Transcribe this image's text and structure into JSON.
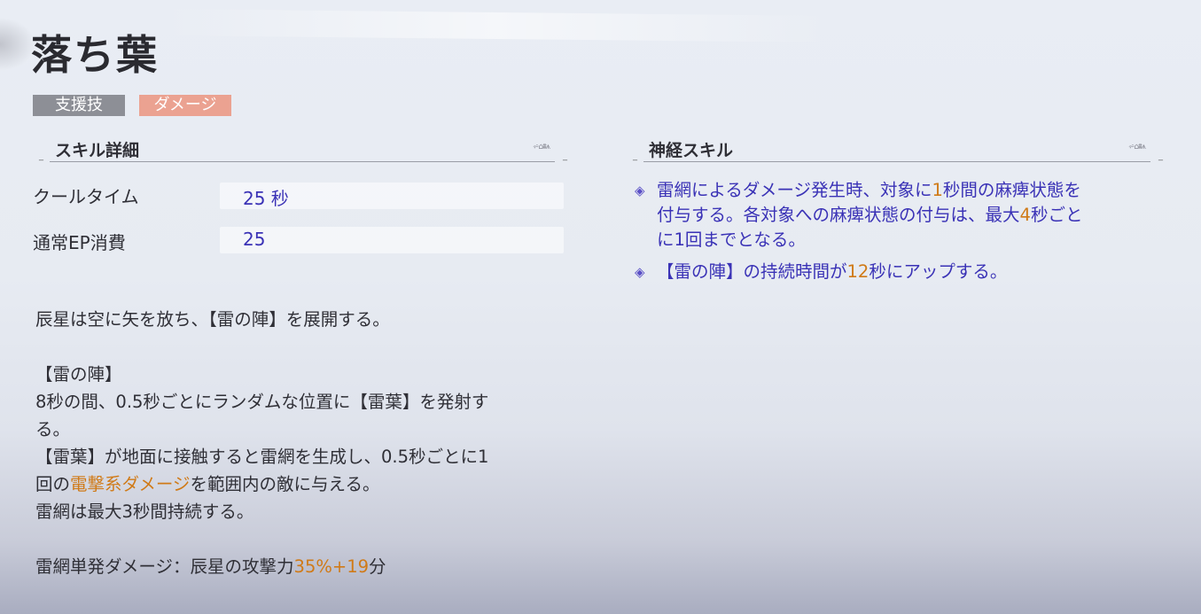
{
  "skill": {
    "title": "落ち葉",
    "tags": [
      "支援技",
      "ダメージ"
    ]
  },
  "details": {
    "section_title": "スキル詳細",
    "cooldown_label": "クールタイム",
    "cooldown_value": "25 秒",
    "ep_label": "通常EP消費",
    "ep_value": "25"
  },
  "description": {
    "line1": "辰星は空に矢を放ち、【雷の陣】を展開する。",
    "line2": "【雷の陣】",
    "line3": "8秒の間、0.5秒ごとにランダムな位置に【雷葉】を発射す",
    "line4": "る。",
    "line5": "【雷葉】が地面に接触すると雷網を生成し、0.5秒ごとに1",
    "line6_pre": "回の",
    "line6_highlight": "電撃系ダメージ",
    "line6_post": "を範囲内の敵に与える。",
    "line7": "雷網は最大3秒間持続する。",
    "line8_pre": "雷網単発ダメージ：辰星の攻撃力",
    "line8_highlight": "35%+19",
    "line8_post": "分"
  },
  "neural": {
    "section_title": "神経スキル",
    "item1": {
      "p1": "雷網によるダメージ発生時、対象に",
      "n1": "1",
      "p2": "秒間の麻痺状態を",
      "p3": "付与する。各対象への麻痺状態の付与は、最大",
      "n2": "4",
      "p4": "秒ごと",
      "p5": "に1回までとなる。"
    },
    "item2": {
      "p1": "【雷の陣】の持続時間が",
      "n1": "12",
      "p2": "秒にアップする。"
    }
  },
  "colors": {
    "accent_text": "#3a32b6",
    "highlight": "#d07a17",
    "tag_support": "#8d8f96",
    "tag_damage": "#eba291"
  },
  "icons": [
    "diamond-bullet-icon",
    "ornament-icon"
  ]
}
